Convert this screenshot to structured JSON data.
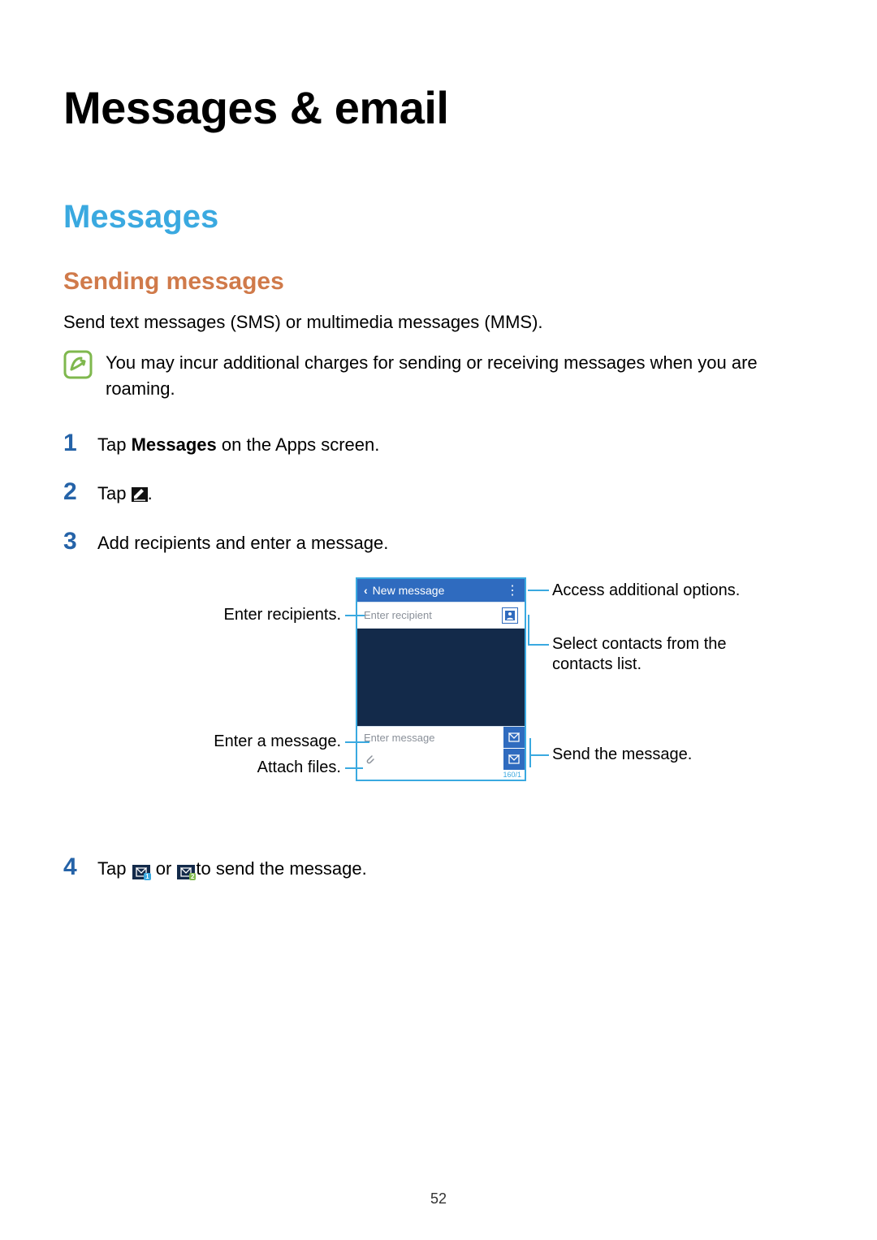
{
  "page_number": "52",
  "chapter_title": "Messages & email",
  "section_title": "Messages",
  "subsection_title": "Sending messages",
  "intro": "Send text messages (SMS) or multimedia messages (MMS).",
  "note": "You may incur additional charges for sending or receiving messages when you are roaming.",
  "steps": {
    "s1": {
      "num": "1",
      "pre": "Tap ",
      "bold": "Messages",
      "post": " on the Apps screen."
    },
    "s2": {
      "num": "2",
      "pre": "Tap ",
      "post": "."
    },
    "s3": {
      "num": "3",
      "text": "Add recipients and enter a message."
    },
    "s4": {
      "num": "4",
      "pre": "Tap ",
      "mid": " or ",
      "post": "to send the message."
    }
  },
  "diagram": {
    "header_title": "New message",
    "recipient_placeholder": "Enter recipient",
    "message_placeholder": "Enter message",
    "counter": "160/1",
    "callouts": {
      "enter_recipients": "Enter recipients.",
      "enter_message": "Enter a message.",
      "attach_files": "Attach files.",
      "additional_options": "Access additional options.",
      "select_contacts": "Select contacts from the contacts list.",
      "send_message": "Send the message."
    }
  }
}
